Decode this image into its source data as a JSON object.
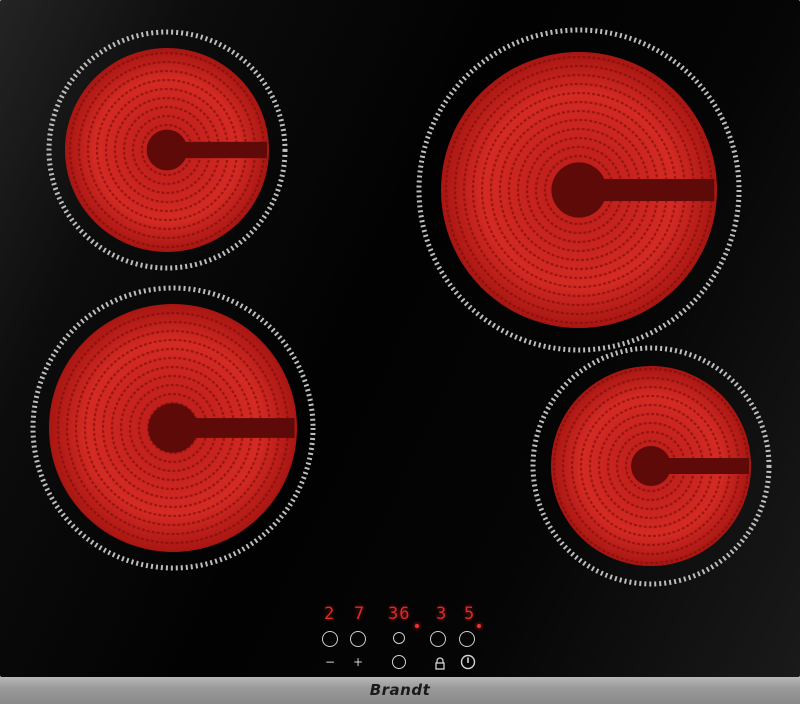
{
  "brand": "Brandt",
  "displays": {
    "front_left": "2",
    "rear_left": "7",
    "timer": "36",
    "rear_right": "3",
    "front_right": "5"
  },
  "controls": {
    "minus_symbol": "−",
    "plus_symbol": "+",
    "timer_symbol": "◷",
    "lock_symbol": "🔒",
    "power_symbol": "⏻"
  },
  "zones": [
    "rear-left",
    "front-left",
    "rear-right",
    "front-right"
  ],
  "colors": {
    "glass": "#050505",
    "hot_zone": "#d32420",
    "display_red": "#e0282a",
    "frame": "#a0a0a0"
  },
  "icons": [
    "timer-icon",
    "key-lock-icon",
    "power-icon"
  ]
}
